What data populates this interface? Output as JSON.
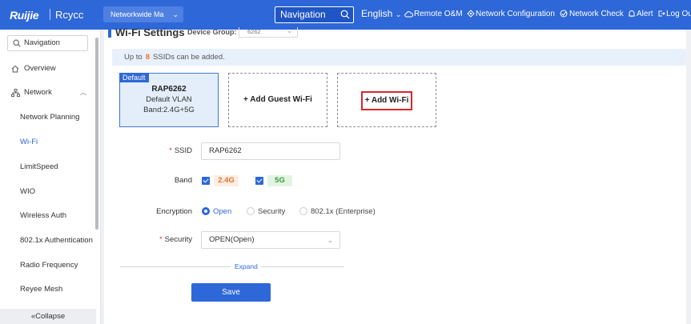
{
  "header": {
    "logo_brand": "Ruijie",
    "logo_product": "Rcycc",
    "network_selector": "Networkwide Ma",
    "navigation_search": "Navigation",
    "language": "English",
    "links": [
      {
        "label": "Remote O&M",
        "icon": "cloud-icon"
      },
      {
        "label": "Network Configuration",
        "icon": "network-config-icon"
      },
      {
        "label": "Network Check",
        "icon": "network-check-icon"
      },
      {
        "label": "Alert",
        "icon": "alert-icon"
      },
      {
        "label": "Log Ou",
        "icon": "logout-icon"
      }
    ]
  },
  "sidebar": {
    "search_placeholder": "Navigation",
    "items": [
      {
        "label": "Overview",
        "icon": "home-icon",
        "level": "top"
      },
      {
        "label": "Network",
        "icon": "network-icon",
        "level": "top",
        "expanded": true
      },
      {
        "label": "Network Planning",
        "level": "sub"
      },
      {
        "label": "Wi-Fi",
        "level": "sub",
        "active": true
      },
      {
        "label": "LimitSpeed",
        "level": "sub"
      },
      {
        "label": "WIO",
        "level": "sub"
      },
      {
        "label": "Wireless Auth",
        "level": "sub"
      },
      {
        "label": "802.1x Authentication",
        "level": "sub"
      },
      {
        "label": "Radio Frequency",
        "level": "sub"
      },
      {
        "label": "Reyee Mesh",
        "level": "sub"
      }
    ],
    "collapse_label": "Collapse"
  },
  "main": {
    "title": "Wi-Fi Settings",
    "device_group_label": "Device Group:",
    "device_group_value": "6262",
    "notice_prefix": "Up to",
    "notice_count": "8",
    "notice_suffix": "SSIDs can be added.",
    "cards": {
      "default_badge": "Default",
      "default_name": "RAP6262",
      "default_vlan": "Default VLAN",
      "default_band": "Band:2.4G+5G",
      "add_guest": "+ Add Guest Wi-Fi",
      "add_wifi": "+ Add Wi-Fi"
    },
    "form": {
      "ssid_label": "SSID",
      "ssid_value": "RAP6262",
      "band_label": "Band",
      "band_24": "2.4G",
      "band_5": "5G",
      "encryption_label": "Encryption",
      "encryption_options": [
        "Open",
        "Security",
        "802.1x (Enterprise)"
      ],
      "encryption_selected": "Open",
      "security_label": "Security",
      "security_value": "OPEN(Open)",
      "expand_label": "Expand",
      "save_label": "Save"
    }
  },
  "colors": {
    "brand": "#2e67d8",
    "warning": "#e8712a",
    "band_24": "#e0742e",
    "band_5": "#3d9a3d",
    "highlight": "#d9262a"
  }
}
